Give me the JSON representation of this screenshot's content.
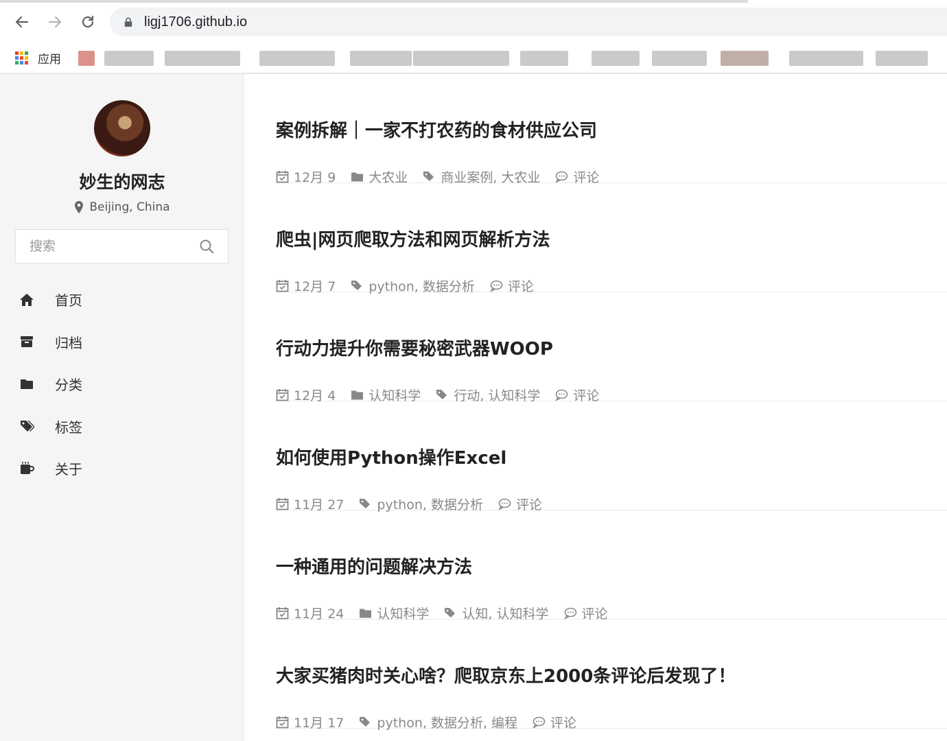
{
  "browser": {
    "url": "ligj1706.github.io",
    "bookmarks": {
      "apps_label": "应用"
    }
  },
  "sidebar": {
    "site_title": "妙生的网志",
    "location": "Beijing, China",
    "search_placeholder": "搜索",
    "menu": [
      {
        "label": "首页",
        "icon": "home-icon"
      },
      {
        "label": "归档",
        "icon": "archive-icon"
      },
      {
        "label": "分类",
        "icon": "folder-icon"
      },
      {
        "label": "标签",
        "icon": "tags-icon"
      },
      {
        "label": "关于",
        "icon": "coffee-icon"
      }
    ]
  },
  "posts": [
    {
      "title": "案例拆解｜一家不打农药的食材供应公司",
      "date": "12月 9",
      "category": "大农业",
      "tags": "商业案例, 大农业",
      "comments": "评论"
    },
    {
      "title": "爬虫|网页爬取方法和网页解析方法",
      "date": "12月 7",
      "category": "",
      "tags": "python, 数据分析",
      "comments": "评论"
    },
    {
      "title": "行动力提升你需要秘密武器WOOP",
      "date": "12月 4",
      "category": "认知科学",
      "tags": "行动, 认知科学",
      "comments": "评论"
    },
    {
      "title": "如何使用Python操作Excel",
      "date": "11月 27",
      "category": "",
      "tags": "python, 数据分析",
      "comments": "评论"
    },
    {
      "title": "一种通用的问题解决方法",
      "date": "11月 24",
      "category": "认知科学",
      "tags": "认知, 认知科学",
      "comments": "评论"
    },
    {
      "title": "大家买猪肉时关心啥？爬取京东上2000条评论后发现了！",
      "date": "11月 17",
      "category": "",
      "tags": "python, 数据分析, 编程",
      "comments": "评论"
    }
  ]
}
